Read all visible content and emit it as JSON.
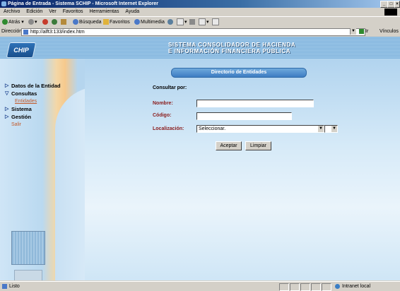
{
  "window": {
    "title": "Página de Entrada - Sistema SCHIP - Microsoft Internet Explorer"
  },
  "menu": [
    "Archivo",
    "Edición",
    "Ver",
    "Favoritos",
    "Herramientas",
    "Ayuda"
  ],
  "toolbar": {
    "back": "Atrás",
    "search": "Búsqueda",
    "favorites": "Favoritos",
    "multimedia": "Multimedia"
  },
  "address": {
    "label": "Dirección",
    "url": "http://alft3:133/index.htm",
    "go": "Ir",
    "links": "Vínculos"
  },
  "header": {
    "line1": "SISTEMA CONSOLIDADOR DE HACIENDA",
    "line2": "E INFORMACIÓN FINANCIERA PÚBLICA",
    "logo": "CHIP"
  },
  "nav": {
    "items": [
      {
        "label": "Datos de la Entidad"
      },
      {
        "label": "Consultas"
      },
      {
        "label": "Entidades"
      },
      {
        "label": "Sistema"
      },
      {
        "label": "Gestión"
      },
      {
        "label": "Salir"
      }
    ]
  },
  "form": {
    "title": "Directorio de Entidades",
    "subtitle": "Consultar por:",
    "nombre_label": "Nombre:",
    "nombre_value": "",
    "codigo_label": "Código:",
    "codigo_value": "",
    "localizacion_label": "Localización:",
    "localizacion_value": "Seleccionar.",
    "accept_label": "Aceptar",
    "clear_label": "Limpiar"
  },
  "status": {
    "text": "Listo",
    "zone": "Intranet local"
  }
}
